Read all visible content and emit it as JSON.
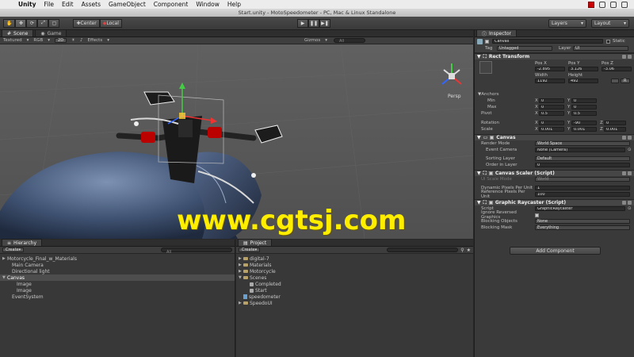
{
  "menubar": {
    "apple": "",
    "items": [
      "Unity",
      "File",
      "Edit",
      "Assets",
      "GameObject",
      "Component",
      "Window",
      "Help"
    ]
  },
  "window": {
    "title": "Start.unity - MotoSpeedometer - PC, Mac & Linux Standalone"
  },
  "toolbar": {
    "center_label": "Center",
    "local_label": "Local",
    "layers_label": "Layers",
    "layout_label": "Layout"
  },
  "scene": {
    "tab_scene": "Scene",
    "tab_game": "Game",
    "shading": "Textured",
    "rgb": "RGB",
    "mode_2d": "2D",
    "effects": "Effects",
    "gizmos": "Gizmos",
    "search_all": "All",
    "persp": "Persp",
    "watermark": "www.cgtsj.com"
  },
  "hierarchy": {
    "tab": "Hierarchy",
    "create": "Create",
    "all": "All",
    "items": [
      {
        "label": "Motorcycle_Final_w_Materials",
        "indent": 0,
        "arrow": "▶",
        "selected": false
      },
      {
        "label": "Main Camera",
        "indent": 1,
        "arrow": "",
        "selected": false
      },
      {
        "label": "Directional light",
        "indent": 1,
        "arrow": "",
        "selected": false
      },
      {
        "label": "Canvas",
        "indent": 0,
        "arrow": "▼",
        "selected": true
      },
      {
        "label": "Image",
        "indent": 2,
        "arrow": "",
        "selected": false
      },
      {
        "label": "Image",
        "indent": 2,
        "arrow": "",
        "selected": false
      },
      {
        "label": "EventSystem",
        "indent": 1,
        "arrow": "",
        "selected": false
      }
    ]
  },
  "project": {
    "tab": "Project",
    "create": "Create",
    "items": [
      {
        "label": "digital-7",
        "indent": 0,
        "type": "folder",
        "arrow": "▶"
      },
      {
        "label": "Materials",
        "indent": 0,
        "type": "folder",
        "arrow": "▶"
      },
      {
        "label": "Motorcycle",
        "indent": 0,
        "type": "folder",
        "arrow": "▶"
      },
      {
        "label": "Scenes",
        "indent": 0,
        "type": "folder",
        "arrow": "▼"
      },
      {
        "label": "Completed",
        "indent": 1,
        "type": "scene",
        "arrow": ""
      },
      {
        "label": "Start",
        "indent": 1,
        "type": "scene",
        "arrow": ""
      },
      {
        "label": "speedometer",
        "indent": 0,
        "type": "script",
        "arrow": ""
      },
      {
        "label": "SpeedoUI",
        "indent": 0,
        "type": "folder",
        "arrow": "▶"
      }
    ]
  },
  "inspector": {
    "tab": "Inspector",
    "object_name": "Canvas",
    "static_label": "Static",
    "tag_label": "Tag",
    "tag_value": "Untagged",
    "layer_label": "Layer",
    "layer_value": "UI",
    "rect_transform": {
      "title": "Rect Transform",
      "pos_x_label": "Pos X",
      "pos_y_label": "Pos Y",
      "pos_z_label": "Pos Z",
      "pos_x": "-2.895",
      "pos_y": "3.126",
      "pos_z": "-3.06",
      "width_label": "Width",
      "height_label": "Height",
      "width": "1192",
      "height": "492",
      "anchors_label": "Anchors",
      "min_label": "Min",
      "max_label": "Max",
      "pivot_label": "Pivot",
      "min_x": "0",
      "min_y": "0",
      "max_x": "0",
      "max_y": "0",
      "pivot_x": "0.5",
      "pivot_y": "0.5",
      "rotation_label": "Rotation",
      "scale_label": "Scale",
      "rot_x": "0",
      "rot_y": "-90",
      "rot_z": "0",
      "scale_x": "0.001",
      "scale_y": "0.001",
      "scale_z": "0.001",
      "x": "X",
      "y": "Y",
      "z": "Z",
      "r_label": "R"
    },
    "canvas": {
      "title": "Canvas",
      "render_mode_label": "Render Mode",
      "render_mode": "World Space",
      "event_camera_label": "Event Camera",
      "event_camera": "None (Camera)",
      "sorting_layer_label": "Sorting Layer",
      "sorting_layer": "Default",
      "order_label": "Order in Layer",
      "order": "0"
    },
    "scaler": {
      "title": "Canvas Scaler (Script)",
      "ui_scale_label": "Ui Scale Mode",
      "ui_scale": "World",
      "dyn_label": "Dynamic Pixels Per Unit",
      "dyn": "1",
      "ref_label": "Reference Pixels Per Unit",
      "ref": "100"
    },
    "raycaster": {
      "title": "Graphic Raycaster (Script)",
      "script_label": "Script",
      "script": "GraphicRaycaster",
      "ignore_label": "Ignore Reversed Graphics",
      "blocking_objects_label": "Blocking Objects",
      "blocking_objects": "None",
      "blocking_mask_label": "Blocking Mask",
      "blocking_mask": "Everything"
    },
    "add_component": "Add Component"
  },
  "colors": {
    "watermark": "#ffee00",
    "accent_red": "#cc0000"
  }
}
